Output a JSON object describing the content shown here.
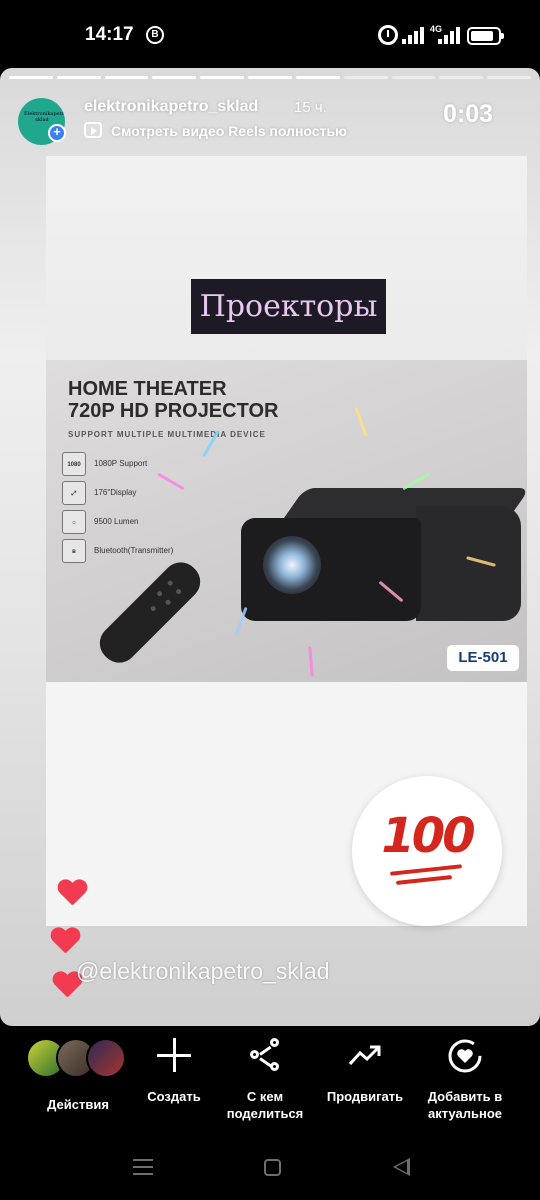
{
  "status_bar": {
    "time": "14:17",
    "vk_badge": "B",
    "network": "4G",
    "icons": [
      "vk-icon",
      "alarm-icon",
      "signal-icon",
      "battery-icon"
    ]
  },
  "story": {
    "progress": {
      "total_segments": 11,
      "completed_segments": 7
    },
    "username": "elektronikapetro_sklad",
    "avatar_text": "Elektronikapetro sklad",
    "time_ago": "15 ч.",
    "reels_link": "Смотреть видео Reels полностью",
    "timer": "0:03",
    "title_badge": "Проекторы",
    "product": {
      "title_line1": "HOME THEATER",
      "title_line2": "720P HD PROJECTOR",
      "subtitle": "SUPPORT MULTIPLE MULTIMEDIA DEVICE",
      "features": [
        {
          "icon": "1080",
          "label": "1080P Support"
        },
        {
          "icon": "⤢",
          "label": "176\"Display"
        },
        {
          "icon": "☼",
          "label": "9500 Lumen"
        },
        {
          "icon": "ʙ",
          "label": "Bluetooth(Transmitter)"
        }
      ],
      "model": "LE-501"
    },
    "sticker": "100",
    "mention": "@elektronikapetro_sklad",
    "colors": {
      "heart": "#f23b50",
      "hundred": "#d4261c",
      "badge_bg": "#1d1a26",
      "badge_text": "#e8c8ee"
    }
  },
  "actions": {
    "activity": "Действия",
    "create": "Создать",
    "share_line1": "С кем",
    "share_line2": "поделиться",
    "promote": "Продвигать",
    "highlight_line1": "Добавить в",
    "highlight_line2": "актуальное"
  },
  "navbar": {
    "icons": [
      "menu-icon",
      "home-icon",
      "back-icon"
    ]
  }
}
